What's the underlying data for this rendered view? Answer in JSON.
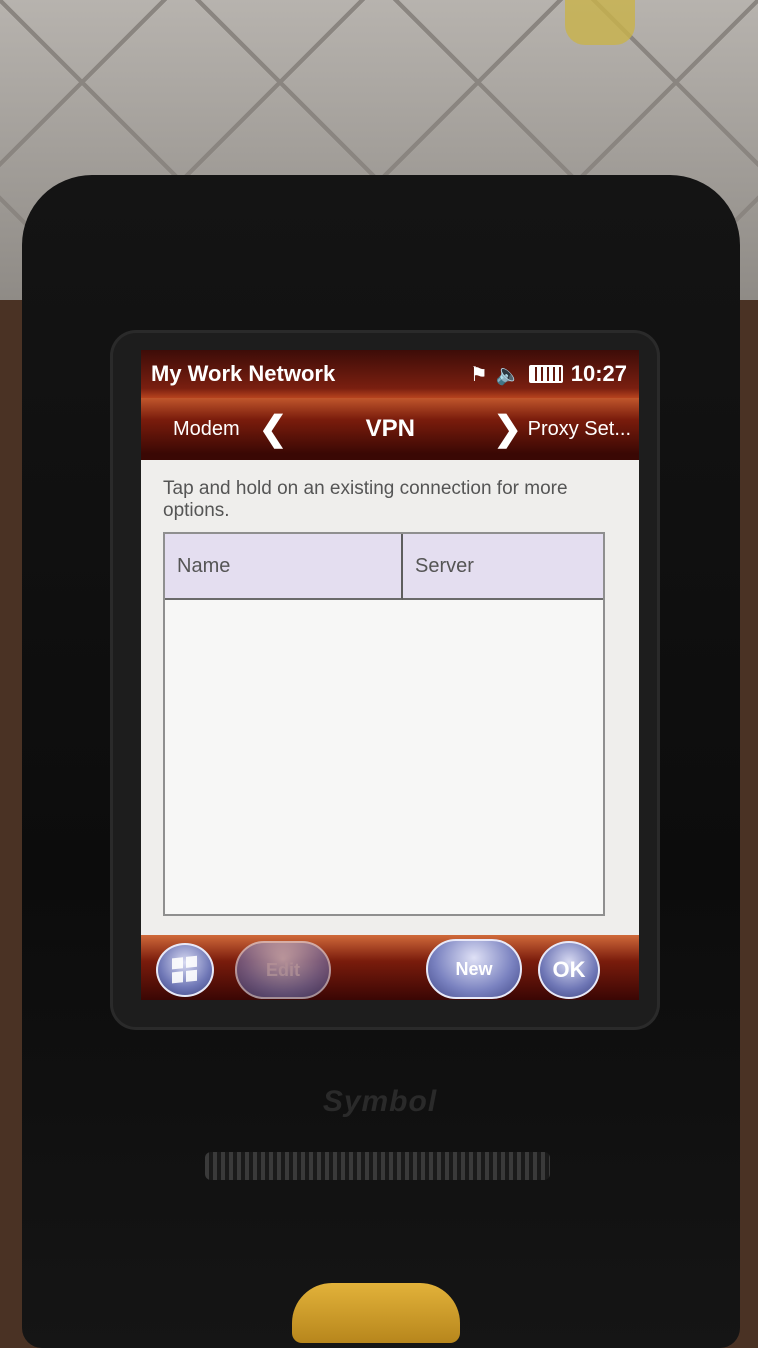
{
  "window": {
    "title": "My Work Network",
    "clock": "10:27"
  },
  "status_icons": [
    "connectivity-icon",
    "speaker-muted-icon",
    "battery-icon"
  ],
  "tabs": {
    "previous": "Modem",
    "current": "VPN",
    "next": "Proxy Set..."
  },
  "hint": "Tap and hold on an existing connection for more options.",
  "table": {
    "columns": [
      "Name",
      "Server"
    ],
    "rows": []
  },
  "softkeys": {
    "edit": "Edit",
    "new": "New",
    "ok": "OK"
  },
  "device": {
    "brand": "Symbol"
  },
  "colors": {
    "title_bar": "#7a1f10",
    "header_cell": "#e4def0",
    "button": "#6f77b6"
  }
}
